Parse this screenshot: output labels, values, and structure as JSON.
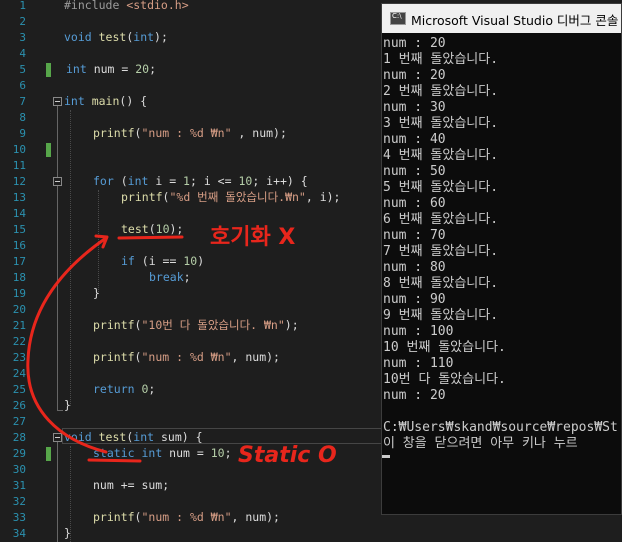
{
  "editor": {
    "line_numbers": [
      "1",
      "2",
      "3",
      "4",
      "5",
      "6",
      "7",
      "8",
      "9",
      "10",
      "11",
      "12",
      "13",
      "14",
      "15",
      "16",
      "17",
      "18",
      "19",
      "20",
      "21",
      "22",
      "23",
      "24",
      "25",
      "26",
      "27",
      "28",
      "29",
      "30",
      "31",
      "32",
      "33",
      "34"
    ],
    "code": {
      "l1_a": "#include ",
      "l1_b": "<stdio.h>",
      "l3_kw": "void ",
      "l3_fn": "test",
      "l3_p": "(",
      "l3_kw2": "int",
      "l3_e": ");",
      "l5_kw": "int ",
      "l5_rest": "num = ",
      "l5_num": "20",
      "l5_e": ";",
      "l7_kw": "int ",
      "l7_fn": "main",
      "l7_rest": "() {",
      "l9_fn": "printf",
      "l9_p": "(",
      "l9_str": "\"num : %d ₩n\"",
      "l9_e": " , num);",
      "l12_kw": "for ",
      "l12_a": "(",
      "l12_kw2": "int ",
      "l12_b": "i = ",
      "l12_n1": "1",
      "l12_c": "; i <= ",
      "l12_n2": "10",
      "l12_d": "; i++) {",
      "l13_fn": "printf",
      "l13_p": "(",
      "l13_str": "\"%d 번째 돌았습니다.₩n\"",
      "l13_e": ", i);",
      "l15_fn": "test",
      "l15_p": "(",
      "l15_num": "10",
      "l15_e": ");",
      "l17_kw": "if ",
      "l17_a": "(i == ",
      "l17_num": "10",
      "l17_e": ")",
      "l18_kw": "break",
      "l18_e": ";",
      "l19": "}",
      "l21_fn": "printf",
      "l21_p": "(",
      "l21_str": "\"10번 다 돌았습니다. ₩n\"",
      "l21_e": ");",
      "l23_fn": "printf",
      "l23_p": "(",
      "l23_str": "\"num : %d ₩n\"",
      "l23_e": ", num);",
      "l25_kw": "return ",
      "l25_num": "0",
      "l25_e": ";",
      "l26": "}",
      "l28_kw": "void ",
      "l28_fn": "test",
      "l28_p": "(",
      "l28_kw2": "int ",
      "l28_e": "sum) {",
      "l29_kw": "static ",
      "l29_kw2": "int ",
      "l29_rest": "num = ",
      "l29_num": "10",
      "l29_e": ";",
      "l31": "num += sum;",
      "l33_fn": "printf",
      "l33_p": "(",
      "l33_str": "\"num : %d ₩n\"",
      "l33_e": ", num);",
      "l34": "}"
    }
  },
  "annotations": {
    "note1": "호기화 X",
    "note2": "Static O",
    "ink_color": "#e8261c"
  },
  "console": {
    "title": "Microsoft Visual Studio 디버그 콘솔",
    "lines": [
      "num : 20",
      "1 번째 돌았습니다.",
      "num : 20",
      "2 번째 돌았습니다.",
      "num : 30",
      "3 번째 돌았습니다.",
      "num : 40",
      "4 번째 돌았습니다.",
      "num : 50",
      "5 번째 돌았습니다.",
      "num : 60",
      "6 번째 돌았습니다.",
      "num : 70",
      "7 번째 돌았습니다.",
      "num : 80",
      "8 번째 돌았습니다.",
      "num : 90",
      "9 번째 돌았습니다.",
      "num : 100",
      "10 번째 돌았습니다.",
      "num : 110",
      "10번 다 돌았습니다.",
      "num : 20",
      "",
      "C:₩Users₩skand₩source₩repos₩St",
      "이 창을 닫으려면 아무 키나 누르"
    ]
  }
}
